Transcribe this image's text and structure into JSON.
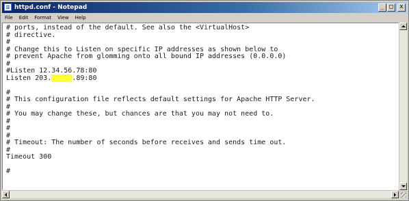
{
  "window": {
    "title": "httpd.conf - Notepad",
    "minimize_label": "_",
    "maximize_label": "□",
    "close_label": "x"
  },
  "menu": [
    "File",
    "Edit",
    "Format",
    "View",
    "Help"
  ],
  "editor_lines": [
    "# ports, instead of the default. See also the <VirtualHost>",
    "# directive.",
    "#",
    "# Change this to Listen on specific IP addresses as shown below to",
    "# prevent Apache from glomming onto all bound IP addresses (0.0.0.0)",
    "#",
    "#Listen 12.34.56.78:80",
    "Listen 203.",
    "",
    "#",
    "# This configuration file reflects default settings for Apache HTTP Server.",
    "#",
    "# You may change these, but chances are that you may not need to.",
    "#",
    "#",
    "#",
    "# Timeout: The number of seconds before receives and sends time out.",
    "#",
    "Timeout 300",
    "",
    "#"
  ],
  "redacted_ip": {
    "prefix": "Listen 203.",
    "redaction": "xxxxx",
    "suffix": ".89:80",
    "highlight_color": "#ffff33"
  }
}
